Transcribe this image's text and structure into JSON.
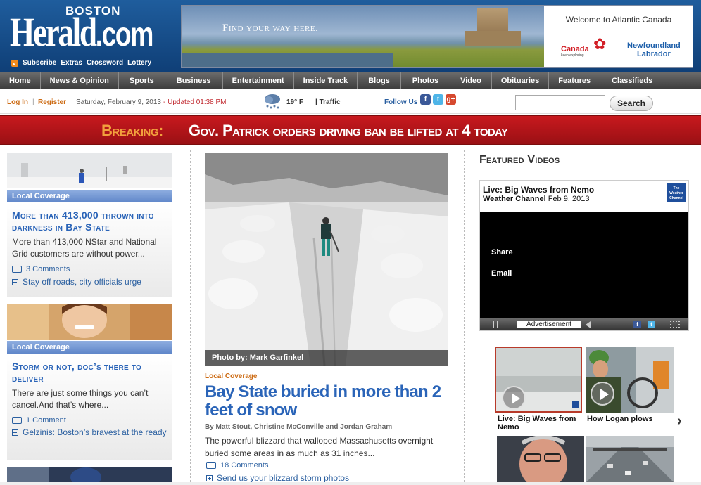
{
  "header": {
    "logo_top": "BOSTON",
    "logo_main": "Herald",
    "logo_suffix": ".com",
    "links": [
      "Subscribe",
      "Extras",
      "Crossword",
      "Lottery"
    ]
  },
  "ad": {
    "tagline": "Find your way here.",
    "welcome": "Welcome to Atlantic Canada",
    "canada": "Canada",
    "canada_sub": "keep exploring",
    "nl_line1": "Newfoundland",
    "nl_line2": "Labrador"
  },
  "nav": {
    "items": [
      "Home",
      "News & Opinion",
      "Sports",
      "Business",
      "Entertainment",
      "Inside Track",
      "Blogs",
      "Photos",
      "Video",
      "Obituaries",
      "Features",
      "Classifieds"
    ]
  },
  "utility": {
    "login": "Log In",
    "sep": "|",
    "register": "Register",
    "date": "Saturday, February 9, 2013",
    "updated": "- Updated 01:38 PM",
    "temp": "19° F",
    "traffic": "| Traffic",
    "follow": "Follow Us",
    "search_button": "Search",
    "search_placeholder": ""
  },
  "breaking": {
    "label": "Breaking:",
    "text": "Gov. Patrick orders driving ban be lifted at 4 today"
  },
  "left_stories": [
    {
      "tag": "Local Coverage",
      "headline": "More than 413,000 thrown into darkness in Bay State",
      "body": "More than 413,000 NStar and National Grid customers are without power...",
      "comments": "3 Comments",
      "link": "Stay off roads, city officials urge"
    },
    {
      "tag": "Local Coverage",
      "headline": "Storm or not, doc’s there to deliver",
      "body": "There are just some things you can’t cancel.And that’s where...",
      "comments": "1 Comment",
      "link": "Gelzinis: Boston’s bravest at the ready"
    }
  ],
  "main_story": {
    "photo_credit": "Photo by: Mark Garfinkel",
    "tag": "Local Coverage",
    "headline": "Bay State buried in more than 2 feet of snow",
    "byline": "By Matt Stout, Christine McConville and Jordan Graham",
    "body": "The powerful blizzard that walloped Massachusetts overnight buried some areas in as much as 31 inches...",
    "comments": "18 Comments",
    "link": "Send us your blizzard storm photos"
  },
  "videos": {
    "section_title": "Featured Videos",
    "player_title": "Live: Big Waves from Nemo",
    "player_source": "Weather Channel",
    "player_date": "Feb 9, 2013",
    "share": "Share",
    "email": "Email",
    "ad_label": "Advertisement",
    "logo_text": "The Weather Channel",
    "thumbs": [
      {
        "caption": "Live: Big Waves from Nemo"
      },
      {
        "caption": "How Logan plows"
      },
      {
        "caption": ""
      },
      {
        "caption": ""
      }
    ]
  }
}
